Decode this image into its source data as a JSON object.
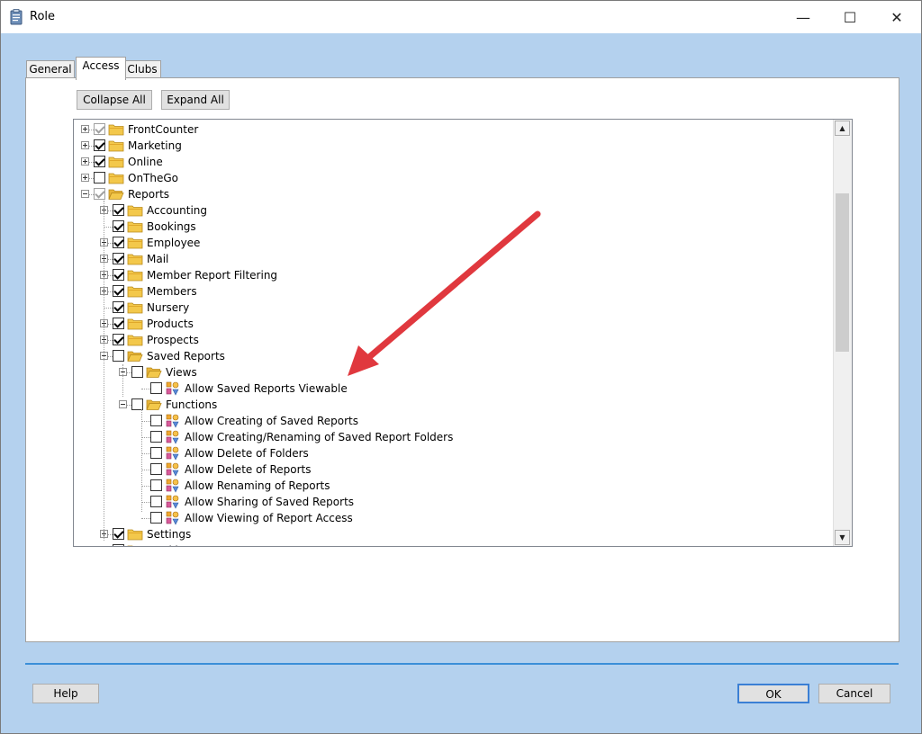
{
  "window": {
    "title": "Role",
    "minimize_glyph": "—",
    "maximize_glyph": "☐",
    "close_glyph": "✕"
  },
  "tabs": [
    {
      "label": "General",
      "active": false
    },
    {
      "label": "Access",
      "active": true
    },
    {
      "label": "Clubs",
      "active": false
    }
  ],
  "toolbar": {
    "collapse_all": "Collapse All",
    "expand_all": "Expand All"
  },
  "tree": [
    {
      "label": "FrontCounter",
      "level": 0,
      "kind": "folder",
      "expander": "plus",
      "checked": true,
      "grey": true
    },
    {
      "label": "Marketing",
      "level": 0,
      "kind": "folder",
      "expander": "plus",
      "checked": true,
      "grey": false
    },
    {
      "label": "Online",
      "level": 0,
      "kind": "folder",
      "expander": "plus",
      "checked": true,
      "grey": false
    },
    {
      "label": "OnTheGo",
      "level": 0,
      "kind": "folder",
      "expander": "plus",
      "checked": false,
      "grey": false
    },
    {
      "label": "Reports",
      "level": 0,
      "kind": "folder-open",
      "expander": "minus",
      "checked": true,
      "grey": true
    },
    {
      "label": "Accounting",
      "level": 1,
      "kind": "folder",
      "expander": "plus",
      "checked": true,
      "grey": false
    },
    {
      "label": "Bookings",
      "level": 1,
      "kind": "folder",
      "expander": "none",
      "checked": true,
      "grey": false
    },
    {
      "label": "Employee",
      "level": 1,
      "kind": "folder",
      "expander": "plus",
      "checked": true,
      "grey": false
    },
    {
      "label": "Mail",
      "level": 1,
      "kind": "folder",
      "expander": "plus",
      "checked": true,
      "grey": false
    },
    {
      "label": "Member Report Filtering",
      "level": 1,
      "kind": "folder",
      "expander": "plus",
      "checked": true,
      "grey": false
    },
    {
      "label": "Members",
      "level": 1,
      "kind": "folder",
      "expander": "plus",
      "checked": true,
      "grey": false
    },
    {
      "label": "Nursery",
      "level": 1,
      "kind": "folder",
      "expander": "none",
      "checked": true,
      "grey": false
    },
    {
      "label": "Products",
      "level": 1,
      "kind": "folder",
      "expander": "plus",
      "checked": true,
      "grey": false
    },
    {
      "label": "Prospects",
      "level": 1,
      "kind": "folder",
      "expander": "plus",
      "checked": true,
      "grey": false
    },
    {
      "label": "Saved Reports",
      "level": 1,
      "kind": "folder-open",
      "expander": "minus",
      "checked": false,
      "grey": false
    },
    {
      "label": "Views",
      "level": 2,
      "kind": "folder-open",
      "expander": "minus",
      "checked": false,
      "grey": false
    },
    {
      "label": "Allow Saved Reports Viewable",
      "level": 3,
      "kind": "perm",
      "expander": "none",
      "checked": false,
      "grey": false
    },
    {
      "label": "Functions",
      "level": 2,
      "kind": "folder-open",
      "expander": "minus",
      "checked": false,
      "grey": false
    },
    {
      "label": "Allow Creating of Saved Reports",
      "level": 3,
      "kind": "perm",
      "expander": "none",
      "checked": false,
      "grey": false
    },
    {
      "label": "Allow Creating/Renaming of Saved Report Folders",
      "level": 3,
      "kind": "perm",
      "expander": "none",
      "checked": false,
      "grey": false
    },
    {
      "label": "Allow Delete of Folders",
      "level": 3,
      "kind": "perm",
      "expander": "none",
      "checked": false,
      "grey": false
    },
    {
      "label": "Allow Delete of Reports",
      "level": 3,
      "kind": "perm",
      "expander": "none",
      "checked": false,
      "grey": false
    },
    {
      "label": "Allow Renaming of Reports",
      "level": 3,
      "kind": "perm",
      "expander": "none",
      "checked": false,
      "grey": false
    },
    {
      "label": "Allow Sharing of Saved Reports",
      "level": 3,
      "kind": "perm",
      "expander": "none",
      "checked": false,
      "grey": false
    },
    {
      "label": "Allow Viewing of Report Access",
      "level": 3,
      "kind": "perm",
      "expander": "none",
      "checked": false,
      "grey": false
    },
    {
      "label": "Settings",
      "level": 1,
      "kind": "folder",
      "expander": "plus",
      "checked": true,
      "grey": false
    },
    {
      "label": "Tracking",
      "level": 1,
      "kind": "folder",
      "expander": "none",
      "checked": false,
      "grey": false
    }
  ],
  "scrollbar": {
    "up_glyph": "▲",
    "down_glyph": "▼"
  },
  "footer": {
    "help": "Help",
    "ok": "OK",
    "cancel": "Cancel"
  },
  "colors": {
    "dialog_bg": "#b4d1ee",
    "folder": "#f3c84b",
    "annotation_arrow": "#e0383e",
    "separator": "#3b8fd8"
  }
}
